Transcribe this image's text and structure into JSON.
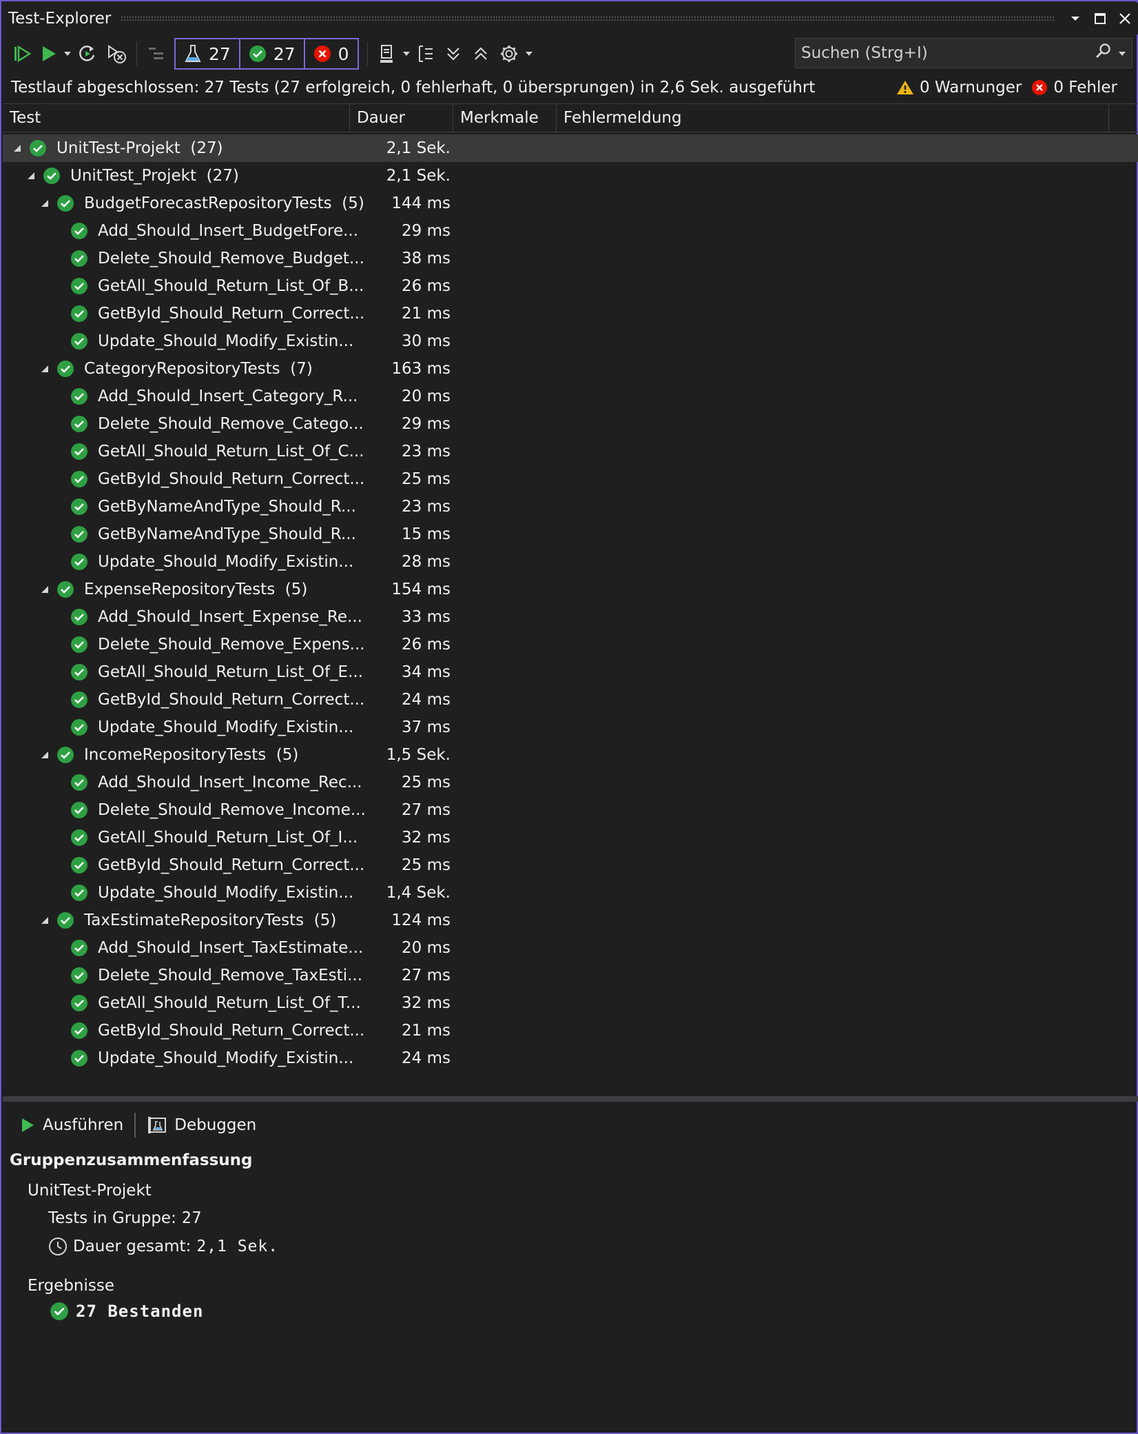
{
  "window": {
    "title": "Test-Explorer"
  },
  "toolbar": {
    "filter_total": "27",
    "filter_passed": "27",
    "filter_failed": "0",
    "search_placeholder": "Suchen (Strg+I)"
  },
  "status": {
    "message": "Testlauf abgeschlossen: 27 Tests (27 erfolgreich, 0 fehlerhaft, 0 übersprungen) in 2,6 Sek. ausgeführt",
    "warnings": "0 Warnunger",
    "errors": "0 Fehler"
  },
  "columns": [
    "Test",
    "Dauer",
    "Merkmale",
    "Fehlermeldung"
  ],
  "tree": [
    {
      "level": 0,
      "name": "UnitTest-Projekt  (27)",
      "duration": "2,1 Sek.",
      "expandable": true,
      "selected": true
    },
    {
      "level": 1,
      "name": "UnitTest_Projekt  (27)",
      "duration": "2,1 Sek.",
      "expandable": true
    },
    {
      "level": 2,
      "name": "BudgetForecastRepositoryTests  (5)",
      "duration": "144 ms",
      "expandable": true
    },
    {
      "level": 3,
      "name": "Add_Should_Insert_BudgetFore...",
      "duration": "29 ms"
    },
    {
      "level": 3,
      "name": "Delete_Should_Remove_Budget...",
      "duration": "38 ms"
    },
    {
      "level": 3,
      "name": "GetAll_Should_Return_List_Of_B...",
      "duration": "26 ms"
    },
    {
      "level": 3,
      "name": "GetById_Should_Return_Correct...",
      "duration": "21 ms"
    },
    {
      "level": 3,
      "name": "Update_Should_Modify_Existin...",
      "duration": "30 ms"
    },
    {
      "level": 2,
      "name": "CategoryRepositoryTests  (7)",
      "duration": "163 ms",
      "expandable": true
    },
    {
      "level": 3,
      "name": "Add_Should_Insert_Category_R...",
      "duration": "20 ms"
    },
    {
      "level": 3,
      "name": "Delete_Should_Remove_Catego...",
      "duration": "29 ms"
    },
    {
      "level": 3,
      "name": "GetAll_Should_Return_List_Of_C...",
      "duration": "23 ms"
    },
    {
      "level": 3,
      "name": "GetById_Should_Return_Correct...",
      "duration": "25 ms"
    },
    {
      "level": 3,
      "name": "GetByNameAndType_Should_R...",
      "duration": "23 ms"
    },
    {
      "level": 3,
      "name": "GetByNameAndType_Should_R...",
      "duration": "15 ms"
    },
    {
      "level": 3,
      "name": "Update_Should_Modify_Existin...",
      "duration": "28 ms"
    },
    {
      "level": 2,
      "name": "ExpenseRepositoryTests  (5)",
      "duration": "154 ms",
      "expandable": true
    },
    {
      "level": 3,
      "name": "Add_Should_Insert_Expense_Re...",
      "duration": "33 ms"
    },
    {
      "level": 3,
      "name": "Delete_Should_Remove_Expens...",
      "duration": "26 ms"
    },
    {
      "level": 3,
      "name": "GetAll_Should_Return_List_Of_E...",
      "duration": "34 ms"
    },
    {
      "level": 3,
      "name": "GetById_Should_Return_Correct...",
      "duration": "24 ms"
    },
    {
      "level": 3,
      "name": "Update_Should_Modify_Existin...",
      "duration": "37 ms"
    },
    {
      "level": 2,
      "name": "IncomeRepositoryTests  (5)",
      "duration": "1,5 Sek.",
      "expandable": true
    },
    {
      "level": 3,
      "name": "Add_Should_Insert_Income_Rec...",
      "duration": "25 ms"
    },
    {
      "level": 3,
      "name": "Delete_Should_Remove_Income...",
      "duration": "27 ms"
    },
    {
      "level": 3,
      "name": "GetAll_Should_Return_List_Of_I...",
      "duration": "32 ms"
    },
    {
      "level": 3,
      "name": "GetById_Should_Return_Correct...",
      "duration": "25 ms"
    },
    {
      "level": 3,
      "name": "Update_Should_Modify_Existin...",
      "duration": "1,4 Sek."
    },
    {
      "level": 2,
      "name": "TaxEstimateRepositoryTests  (5)",
      "duration": "124 ms",
      "expandable": true
    },
    {
      "level": 3,
      "name": "Add_Should_Insert_TaxEstimate...",
      "duration": "20 ms"
    },
    {
      "level": 3,
      "name": "Delete_Should_Remove_TaxEsti...",
      "duration": "27 ms"
    },
    {
      "level": 3,
      "name": "GetAll_Should_Return_List_Of_T...",
      "duration": "32 ms"
    },
    {
      "level": 3,
      "name": "GetById_Should_Return_Correct...",
      "duration": "21 ms"
    },
    {
      "level": 3,
      "name": "Update_Should_Modify_Existin...",
      "duration": "24 ms"
    }
  ],
  "details": {
    "run_label": "Ausführen",
    "debug_label": "Debuggen",
    "summary_title": "Gruppenzusammenfassung",
    "group_name": "UnitTest-Projekt",
    "tests_label": "Tests in Gruppe:",
    "tests_value": "27",
    "duration_label": "Dauer gesamt:",
    "duration_value": "2,1 Sek.",
    "results_title": "Ergebnisse",
    "passed_text": "27 Bestanden"
  },
  "colors": {
    "accent": "#6b57c9",
    "success": "#2ea043",
    "error": "#e51400",
    "warning": "#e7b416"
  }
}
